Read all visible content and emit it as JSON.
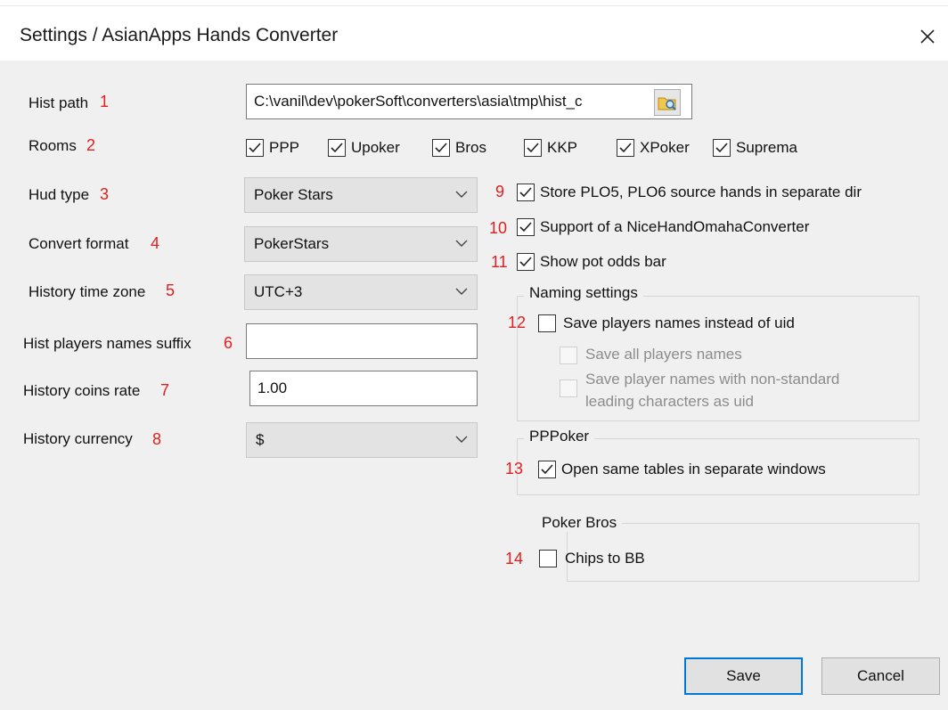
{
  "window": {
    "title": "Settings / AsianApps Hands Converter"
  },
  "fields": {
    "hist_path": {
      "label": "Hist path",
      "num": "1",
      "value": "C:\\vanil\\dev\\pokerSoft\\converters\\asia\\tmp\\hist_c"
    },
    "rooms": {
      "label": "Rooms",
      "num": "2",
      "items": [
        {
          "label": "PPP",
          "checked": true
        },
        {
          "label": "Upoker",
          "checked": true
        },
        {
          "label": "Bros",
          "checked": true
        },
        {
          "label": "KKP",
          "checked": true
        },
        {
          "label": "XPoker",
          "checked": true
        },
        {
          "label": "Suprema",
          "checked": true
        }
      ]
    },
    "hud_type": {
      "label": "Hud type",
      "num": "3",
      "value": "Poker Stars"
    },
    "convert_format": {
      "label": "Convert format",
      "num": "4",
      "value": "PokerStars"
    },
    "time_zone": {
      "label": "History time zone",
      "num": "5",
      "value": "UTC+3"
    },
    "names_suffix": {
      "label": "Hist players names suffix",
      "num": "6",
      "value": ""
    },
    "coins_rate": {
      "label": "History coins rate",
      "num": "7",
      "value": "1.00"
    },
    "currency": {
      "label": "History currency",
      "num": "8",
      "value": "$"
    }
  },
  "options": {
    "store_plo": {
      "num": "9",
      "label": "Store PLO5, PLO6 source hands in separate dir",
      "checked": true
    },
    "nice_hand": {
      "num": "10",
      "label": "Support of a NiceHandOmahaConverter",
      "checked": true
    },
    "pot_odds": {
      "num": "11",
      "label": "Show pot odds bar",
      "checked": true
    }
  },
  "naming": {
    "title": "Naming settings",
    "save_names": {
      "num": "12",
      "label": "Save players names instead of uid",
      "checked": false
    },
    "save_all": {
      "label": "Save all players names",
      "checked": false
    },
    "nonstandard": {
      "label_line1": "Save player names with non-standard",
      "label_line2": "leading characters as uid",
      "checked": false
    }
  },
  "ppp": {
    "title": "PPPoker",
    "open_same": {
      "num": "13",
      "label": "Open same tables in separate windows",
      "checked": true
    }
  },
  "bros": {
    "title": "Poker Bros",
    "chips_bb": {
      "num": "14",
      "label": "Chips to BB",
      "checked": false
    }
  },
  "buttons": {
    "save": "Save",
    "cancel": "Cancel"
  },
  "icons": {
    "close": "close-icon",
    "browse": "folder-browse-icon",
    "dropdown": "chevron-down-icon",
    "check": "check-icon"
  },
  "colors": {
    "annotation": "#e02020",
    "accent": "#0078d7"
  }
}
